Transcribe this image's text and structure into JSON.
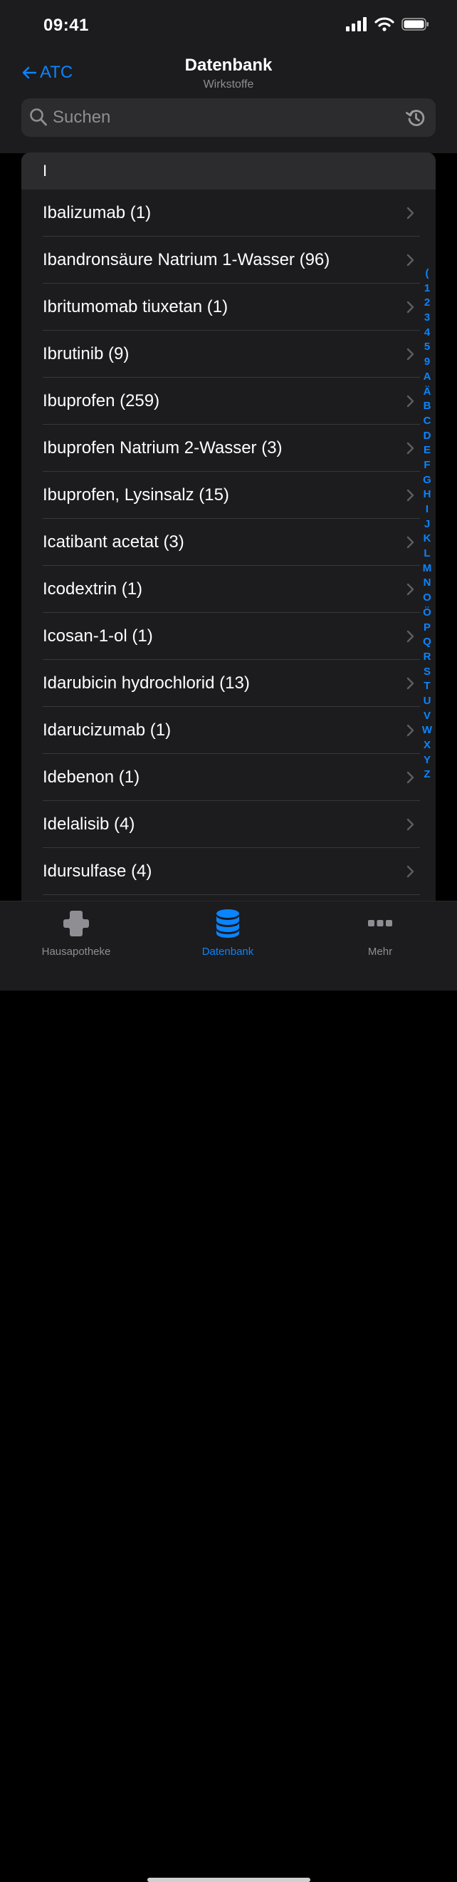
{
  "status_bar": {
    "time": "09:41"
  },
  "nav": {
    "back_label": "ATC",
    "title": "Datenbank",
    "subtitle": "Wirkstoffe"
  },
  "search": {
    "placeholder": "Suchen",
    "value": ""
  },
  "section": {
    "header": "I"
  },
  "items": [
    {
      "label": "Ibalizumab (1)"
    },
    {
      "label": "Ibandronsäure Natrium 1-Wasser (96)"
    },
    {
      "label": "Ibritumomab tiuxetan (1)"
    },
    {
      "label": "Ibrutinib (9)"
    },
    {
      "label": "Ibuprofen (259)"
    },
    {
      "label": "Ibuprofen Natrium 2-Wasser (3)"
    },
    {
      "label": "Ibuprofen, Lysinsalz (15)"
    },
    {
      "label": "Icatibant acetat (3)"
    },
    {
      "label": "Icodextrin (1)"
    },
    {
      "label": "Icosan-1-ol (1)"
    },
    {
      "label": "Idarubicin hydrochlorid (13)"
    },
    {
      "label": "Idarucizumab (1)"
    },
    {
      "label": "Idebenon (1)"
    },
    {
      "label": "Idelalisib (4)"
    },
    {
      "label": "Idursulfase (4)"
    }
  ],
  "index_letters": [
    "(",
    "1",
    "2",
    "3",
    "4",
    "5",
    "9",
    "A",
    "Ä",
    "B",
    "C",
    "D",
    "E",
    "F",
    "G",
    "H",
    "I",
    "J",
    "K",
    "L",
    "M",
    "N",
    "O",
    "Ö",
    "P",
    "Q",
    "R",
    "S",
    "T",
    "U",
    "V",
    "W",
    "X",
    "Y",
    "Z"
  ],
  "tabs": [
    {
      "label": "Hausapotheke",
      "icon": "cross-icon",
      "active": false
    },
    {
      "label": "Datenbank",
      "icon": "database-icon",
      "active": true
    },
    {
      "label": "Mehr",
      "icon": "ellipsis-icon",
      "active": false
    }
  ],
  "colors": {
    "accent": "#0a84ff",
    "background": "#000000",
    "surface": "#1c1c1e",
    "secondary_text": "#8e8e93"
  }
}
